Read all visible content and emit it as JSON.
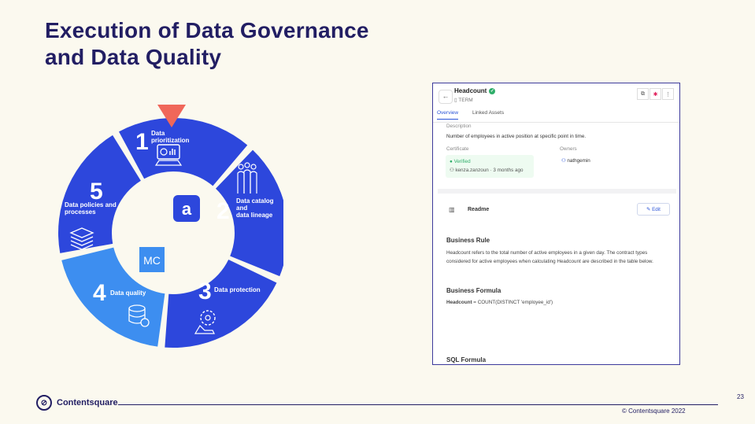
{
  "slide": {
    "title_line1": "Execution of Data Governance",
    "title_line2": "and Data Quality",
    "page_number": "23",
    "copyright": "© Contentsquare 2022",
    "brand": "Contentsquare"
  },
  "wheel": {
    "segments": [
      {
        "num": "1",
        "label": [
          "Data",
          "prioritization"
        ],
        "icon": "dashboard-monitor-icon",
        "color": "#2d47dc"
      },
      {
        "num": "2",
        "label": [
          "Data catalog",
          "and",
          "data lineage"
        ],
        "icon": "team-people-icon",
        "color": "#2d47dc"
      },
      {
        "num": "3",
        "label": [
          "Data protection"
        ],
        "icon": "gear-hand-icon",
        "color": "#2d47dc"
      },
      {
        "num": "4",
        "label": [
          "Data quality"
        ],
        "icon": "database-icon",
        "color": "#3d8ef0"
      },
      {
        "num": "5",
        "label": [
          "Data policies and",
          "processes"
        ],
        "icon": "document-stack-icon",
        "color": "#2d47dc"
      }
    ],
    "center_logo_a": "a",
    "center_logo_mc": "MC",
    "pointer_color": "#f0675a"
  },
  "app": {
    "asset_name": "Headcount",
    "asset_type": "TERM",
    "tabs": [
      "Overview",
      "Linked Assets"
    ],
    "description_label": "Description",
    "description": "Number of employees in active position at specific point in time.",
    "certificate_label": "Certificate",
    "certificate_status": "Verified",
    "certified_by": "kenza.zanzoun · 3 months ago",
    "owners_label": "Owners",
    "owner": "nathgemin",
    "readme_label": "Readme",
    "edit_label": "Edit",
    "business_rule_title": "Business Rule",
    "business_rule_text": "Headcount refers to the total number of active employees in a given day. The contract types considered for active employees when calculating Headcount are described in the table below.",
    "business_formula_title": "Business Formula",
    "formula_name": "Headcount",
    "formula_expr": " = COUNT(DISTINCT 'employee_id')",
    "sql_formula_title": "SQL Formula"
  }
}
